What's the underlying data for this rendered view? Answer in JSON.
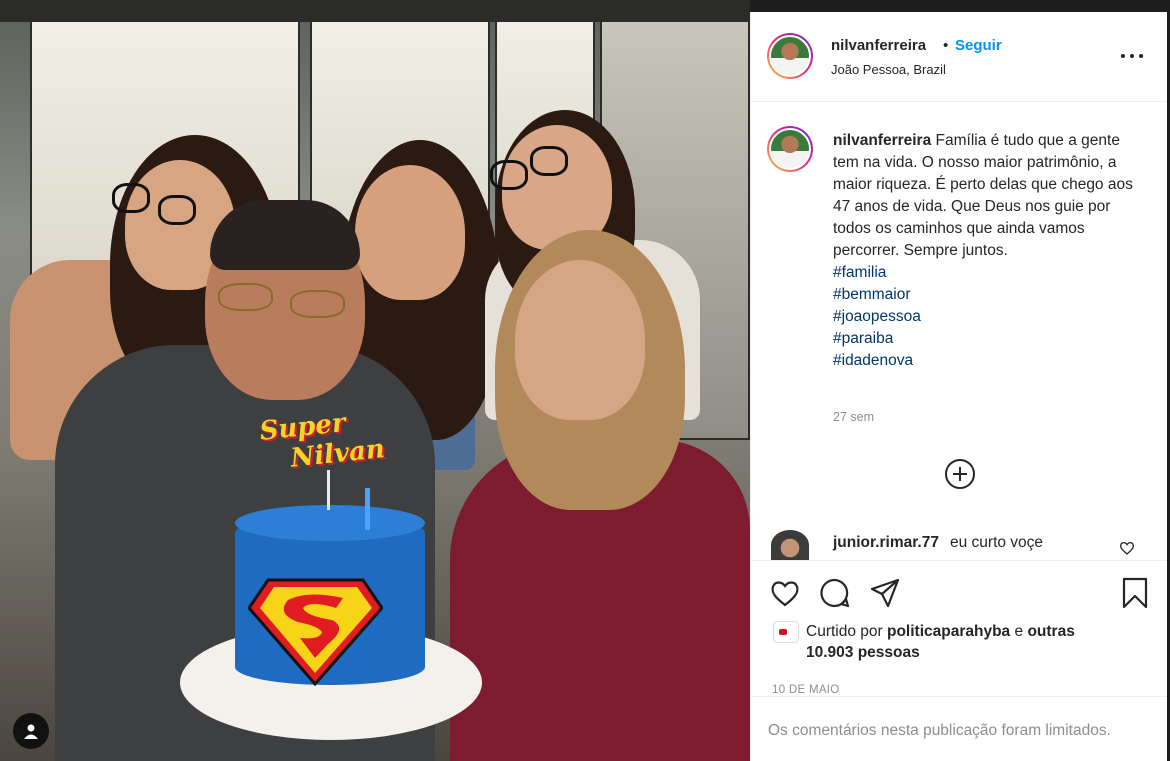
{
  "post": {
    "username": "nilvanferreira",
    "separator": "•",
    "follow_label": "Seguir",
    "location": "João Pessoa, Brazil",
    "more_icon": "more-horizontal-icon"
  },
  "caption": {
    "username": "nilvanferreira",
    "text": "Família é tudo que a gente tem na vida. O nosso maior patrimônio, a maior riqueza. É perto delas que chego aos 47 anos de vida. Que Deus nos guie por todos os caminhos que ainda vamos percorrer. Sempre juntos.",
    "hashtags": [
      "#familia",
      "#bemmaior",
      "#joaopessoa",
      "#paraiba",
      "#idadenova"
    ],
    "time": "27 sem"
  },
  "comments": [
    {
      "username": "junior.rimar.77",
      "text": "eu curto voçe"
    }
  ],
  "photo": {
    "topper_line1": "Super",
    "topper_line2": "Nilvan"
  },
  "actions": {
    "icons": [
      "heart-icon",
      "comment-icon",
      "share-icon",
      "bookmark-icon"
    ]
  },
  "likes": {
    "prefix": "Curtido por",
    "liker": "politicaparahyba",
    "conjunction": "e",
    "others": "outras 10.903 pessoas"
  },
  "date": "10 DE MAIO",
  "comments_limited": "Os comentários nesta publicação foram limitados.",
  "colors": {
    "link_blue": "#0095f6",
    "hashtag": "#00376b",
    "muted": "#8e8e8e",
    "text": "#262626"
  }
}
